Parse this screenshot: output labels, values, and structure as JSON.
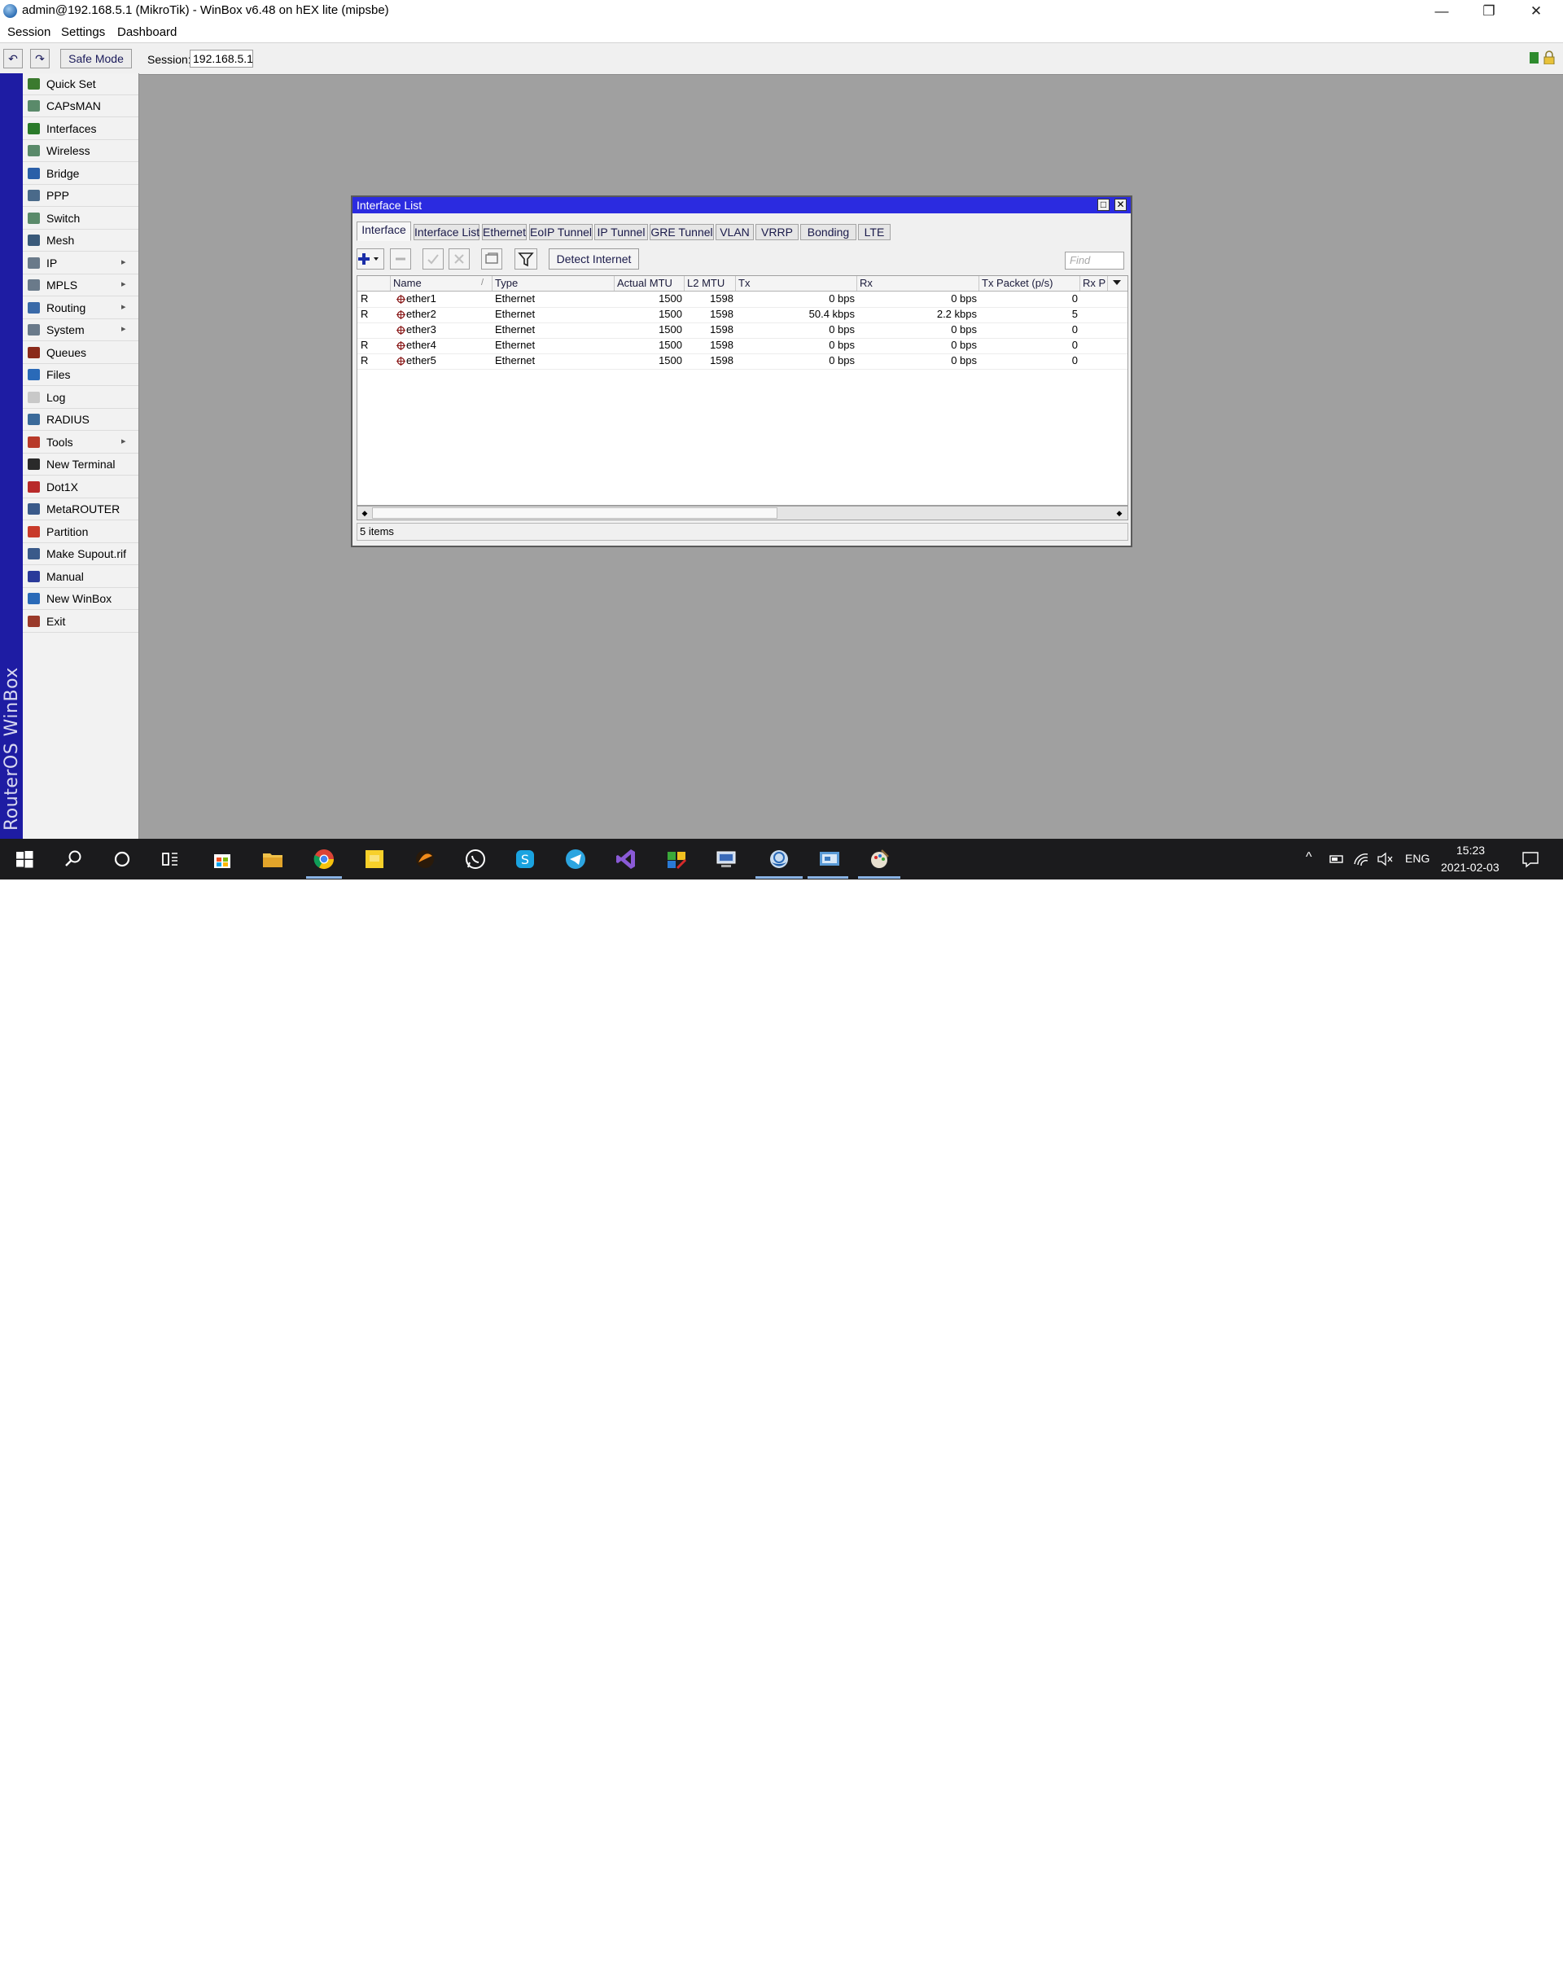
{
  "window": {
    "title": "admin@192.168.5.1 (MikroTik) - WinBox v6.48 on hEX lite (mipsbe)",
    "minimize_glyph": "—",
    "restore_glyph": "❐",
    "close_glyph": "✕"
  },
  "menubar": [
    "Session",
    "Settings",
    "Dashboard"
  ],
  "toolbar": {
    "undo_icon": "↶",
    "redo_icon": "↷",
    "safe_mode_label": "Safe Mode",
    "session_label": "Session:",
    "session_value": "192.168.5.1"
  },
  "brand": "RouterOS WinBox",
  "sidebar": {
    "items": [
      {
        "label": "Quick Set",
        "icon": "wand-icon",
        "color": "#3b7a2e"
      },
      {
        "label": "CAPsMAN",
        "icon": "antenna-icon",
        "color": "#5a8a6a"
      },
      {
        "label": "Interfaces",
        "icon": "interfaces-icon",
        "color": "#2a7a2a"
      },
      {
        "label": "Wireless",
        "icon": "wireless-icon",
        "color": "#5a8a6a"
      },
      {
        "label": "Bridge",
        "icon": "bridge-icon",
        "color": "#2a5fa8"
      },
      {
        "label": "PPP",
        "icon": "ppp-icon",
        "color": "#4a6a8a"
      },
      {
        "label": "Switch",
        "icon": "switch-icon",
        "color": "#5a8a6a"
      },
      {
        "label": "Mesh",
        "icon": "mesh-icon",
        "color": "#3a5a7a"
      },
      {
        "label": "IP",
        "icon": "ip-icon",
        "color": "#6a7a8a",
        "submenu": true
      },
      {
        "label": "MPLS",
        "icon": "mpls-icon",
        "color": "#6a7a8a",
        "submenu": true
      },
      {
        "label": "Routing",
        "icon": "routing-icon",
        "color": "#3a6aa8",
        "submenu": true
      },
      {
        "label": "System",
        "icon": "system-icon",
        "color": "#6a7a8a",
        "submenu": true
      },
      {
        "label": "Queues",
        "icon": "queues-icon",
        "color": "#8a2a1a"
      },
      {
        "label": "Files",
        "icon": "files-icon",
        "color": "#2a6ab8"
      },
      {
        "label": "Log",
        "icon": "log-icon",
        "color": "#c8c8c8"
      },
      {
        "label": "RADIUS",
        "icon": "radius-icon",
        "color": "#3a6a9a"
      },
      {
        "label": "Tools",
        "icon": "tools-icon",
        "color": "#b83a2a",
        "submenu": true
      },
      {
        "label": "New Terminal",
        "icon": "terminal-icon",
        "color": "#2a2a2a"
      },
      {
        "label": "Dot1X",
        "icon": "dot1x-icon",
        "color": "#b82a2a"
      },
      {
        "label": "MetaROUTER",
        "icon": "metarouter-icon",
        "color": "#3a5a8a"
      },
      {
        "label": "Partition",
        "icon": "partition-icon",
        "color": "#c83a2a"
      },
      {
        "label": "Make Supout.rif",
        "icon": "supout-icon",
        "color": "#3a5a8a"
      },
      {
        "label": "Manual",
        "icon": "manual-icon",
        "color": "#2a3a9a"
      },
      {
        "label": "New WinBox",
        "icon": "winbox-icon",
        "color": "#2a6ab8"
      },
      {
        "label": "Exit",
        "icon": "exit-icon",
        "color": "#9a3a2a"
      }
    ],
    "submenu_arrow": "▸"
  },
  "iface_window": {
    "title": "Interface List",
    "max_glyph": "□",
    "close_glyph": "✕",
    "tabs": [
      "Interface",
      "Interface List",
      "Ethernet",
      "EoIP Tunnel",
      "IP Tunnel",
      "GRE Tunnel",
      "VLAN",
      "VRRP",
      "Bonding",
      "LTE"
    ],
    "active_tab": "Interface",
    "detect_label": "Detect Internet",
    "find_placeholder": "Find",
    "columns": [
      "",
      "Name",
      "Type",
      "Actual MTU",
      "L2 MTU",
      "Tx",
      "Rx",
      "Tx Packet (p/s)",
      "Rx P"
    ],
    "sort_indicator": "/",
    "rows": [
      {
        "flag": "R",
        "name": "ether1",
        "type": "Ethernet",
        "mtu": "1500",
        "l2mtu": "1598",
        "tx": "0 bps",
        "rx": "0 bps",
        "txp": "0"
      },
      {
        "flag": "R",
        "name": "ether2",
        "type": "Ethernet",
        "mtu": "1500",
        "l2mtu": "1598",
        "tx": "50.4 kbps",
        "rx": "2.2 kbps",
        "txp": "5"
      },
      {
        "flag": "",
        "name": "ether3",
        "type": "Ethernet",
        "mtu": "1500",
        "l2mtu": "1598",
        "tx": "0 bps",
        "rx": "0 bps",
        "txp": "0"
      },
      {
        "flag": "R",
        "name": "ether4",
        "type": "Ethernet",
        "mtu": "1500",
        "l2mtu": "1598",
        "tx": "0 bps",
        "rx": "0 bps",
        "txp": "0"
      },
      {
        "flag": "R",
        "name": "ether5",
        "type": "Ethernet",
        "mtu": "1500",
        "l2mtu": "1598",
        "tx": "0 bps",
        "rx": "0 bps",
        "txp": "0"
      }
    ],
    "status": "5 items",
    "scroll_left": "◆",
    "scroll_right": "◆"
  },
  "taskbar": {
    "apps": [
      "windows-start",
      "search",
      "cortana",
      "task-view",
      "store",
      "file-explorer",
      "chrome",
      "sticky-notes",
      "app-orange",
      "whatsapp",
      "skype",
      "telegram",
      "visual-studio",
      "excel-like",
      "network-app",
      "winbox",
      "remote-desktop",
      "paint-app"
    ],
    "tray": {
      "lang": "ENG",
      "time": "15:23",
      "date": "2021-02-03",
      "chevron": "^"
    }
  },
  "colors": {
    "window_title": "#2b2be0",
    "brand_bar": "#1e1ca3",
    "desktop": "#a0a0a0",
    "taskbar": "#1b1b1d"
  }
}
